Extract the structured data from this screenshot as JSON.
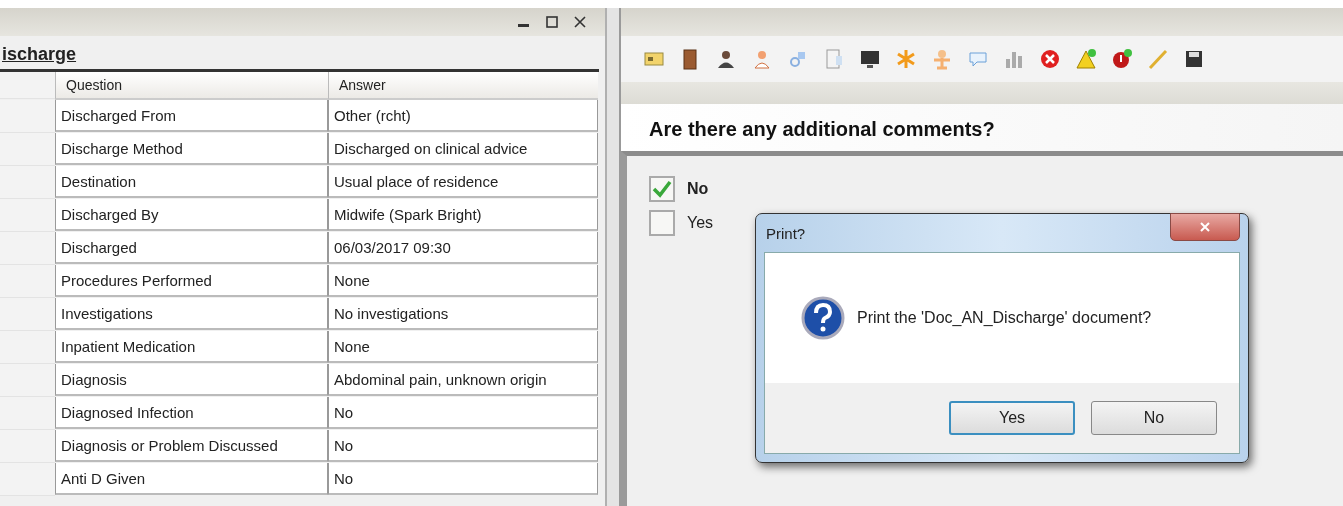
{
  "left_window": {
    "title": "ischarge",
    "table": {
      "columns": [
        "Question",
        "Answer"
      ],
      "rows": [
        [
          "Discharged From",
          "Other (rcht)"
        ],
        [
          "Discharge Method",
          "Discharged on clinical advice"
        ],
        [
          "Destination",
          "Usual place of residence"
        ],
        [
          "Discharged By",
          "Midwife (Spark Bright)"
        ],
        [
          "Discharged",
          "06/03/2017 09:30"
        ],
        [
          "Procedures Performed",
          "None"
        ],
        [
          "Investigations",
          "No investigations"
        ],
        [
          "Inpatient Medication",
          "None"
        ],
        [
          "Diagnosis",
          "Abdominal pain, unknown origin"
        ],
        [
          "Diagnosed Infection",
          "No"
        ],
        [
          "Diagnosis or Problem Discussed",
          "No"
        ],
        [
          "Anti D Given",
          "No"
        ]
      ]
    }
  },
  "right_window": {
    "question": "Are there any additional comments?",
    "options": [
      {
        "label": "No",
        "checked": true
      },
      {
        "label": "Yes",
        "checked": false
      }
    ]
  },
  "dialog": {
    "title": "Print?",
    "message": "Print the 'Doc_AN_Discharge' document?",
    "buttons": [
      {
        "label": "Yes",
        "focused": true
      },
      {
        "label": "No",
        "focused": false
      }
    ]
  }
}
